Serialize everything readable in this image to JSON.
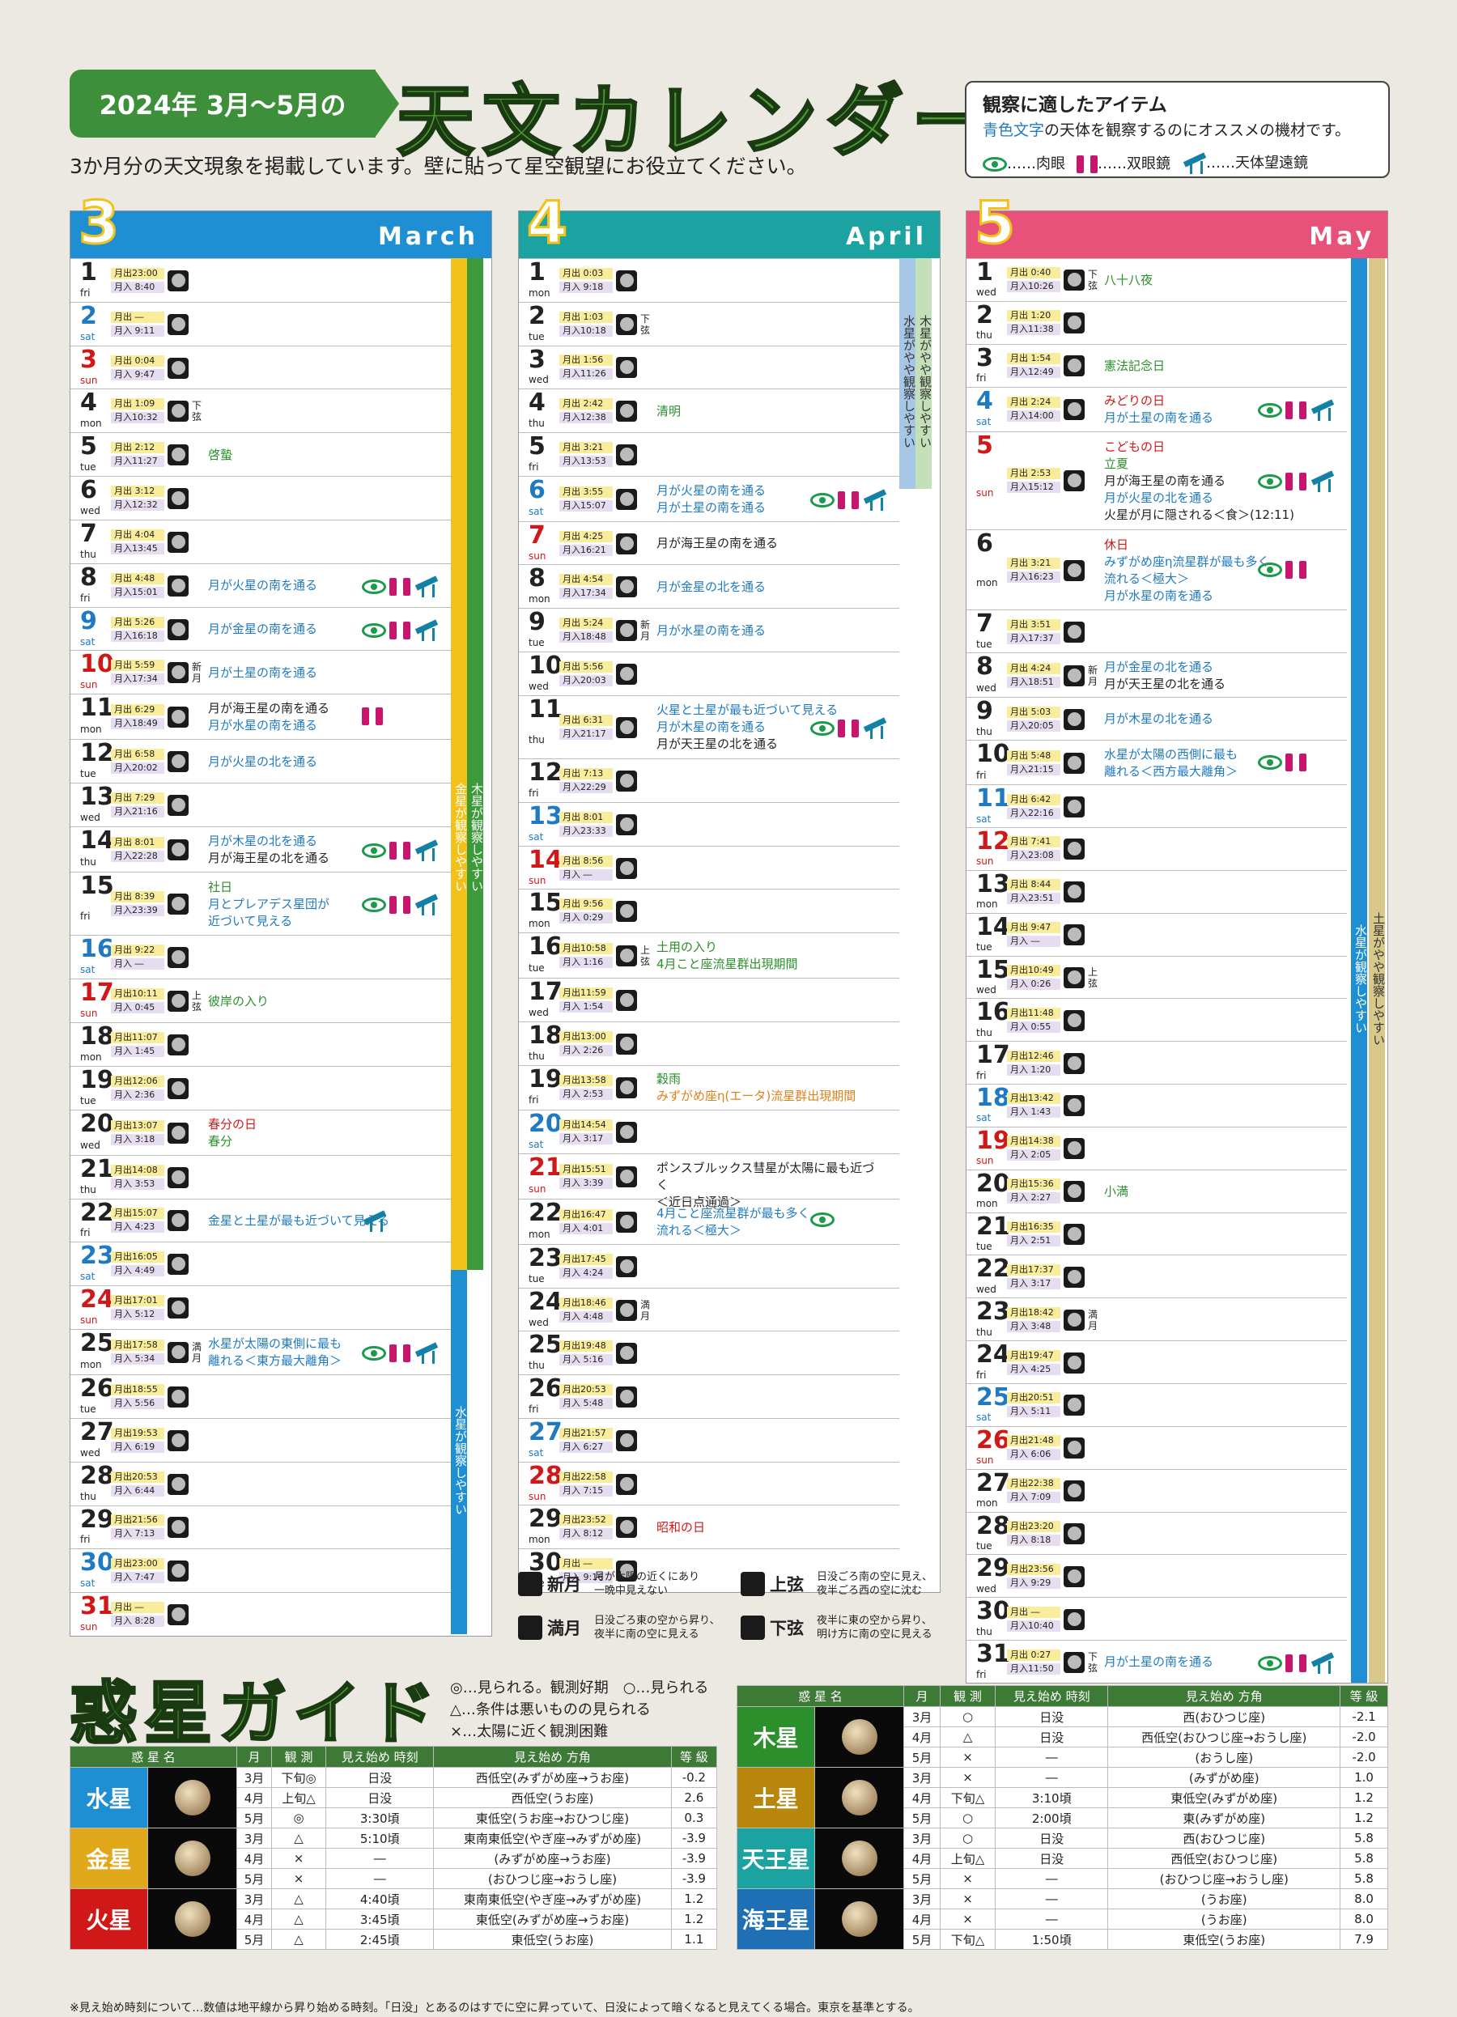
{
  "header": {
    "badge": "2024年 3月～5月の",
    "title": "天文カレンダー",
    "subtitle": "3か月分の天文現象を掲載しています。壁に貼って星空観望にお役立てください。"
  },
  "items_box": {
    "title": "観察に適したアイテム",
    "desc_blue": "青色文字",
    "desc_rest": "の天体を観察するのにオススメの機材です。",
    "eye": "……肉眼",
    "bino": "……双眼鏡",
    "tel": "……天体望遠鏡"
  },
  "months": [
    {
      "num": "3",
      "name": "March",
      "color": "#1f8fd4",
      "days": [
        [
          "1",
          "fri",
          "月出23:00",
          "月入 8:40",
          "",
          "",
          ""
        ],
        [
          "2",
          "sat",
          "月出 ―",
          "月入 9:11",
          "",
          "",
          ""
        ],
        [
          "3",
          "sun",
          "月出 0:04",
          "月入 9:47",
          "",
          "",
          ""
        ],
        [
          "4",
          "mon",
          "月出 1:09",
          "月入10:32",
          "下弦",
          "",
          ""
        ],
        [
          "5",
          "tue",
          "月出 2:12",
          "月入11:27",
          "",
          "啓蟄",
          ""
        ],
        [
          "6",
          "wed",
          "月出 3:12",
          "月入12:32",
          "",
          "",
          ""
        ],
        [
          "7",
          "thu",
          "月出 4:04",
          "月入13:45",
          "",
          "",
          ""
        ],
        [
          "8",
          "fri",
          "月出 4:48",
          "月入15:01",
          "",
          "月が火星の南を通る",
          "EBT"
        ],
        [
          "9",
          "sat",
          "月出 5:26",
          "月入16:18",
          "",
          "月が金星の南を通る",
          "EBT"
        ],
        [
          "10",
          "sun",
          "月出 5:59",
          "月入17:34",
          "新月",
          "月が土星の南を通る",
          ""
        ],
        [
          "11",
          "mon",
          "月出 6:29",
          "月入18:49",
          "",
          "月が海王星の南を通る\n月が水星の南を通る",
          "B"
        ],
        [
          "12",
          "tue",
          "月出 6:58",
          "月入20:02",
          "",
          "月が火星の北を通る",
          ""
        ],
        [
          "13",
          "wed",
          "月出 7:29",
          "月入21:16",
          "",
          "",
          ""
        ],
        [
          "14",
          "thu",
          "月出 8:01",
          "月入22:28",
          "",
          "月が木星の北を通る\n月が海王星の北を通る",
          "EBT"
        ],
        [
          "15",
          "fri",
          "月出 8:39",
          "月入23:39",
          "",
          "社日\n月とプレアデス星団が\n近づいて見える",
          "EBT"
        ],
        [
          "16",
          "sat",
          "月出 9:22",
          "月入 ―",
          "",
          "",
          ""
        ],
        [
          "17",
          "sun",
          "月出10:11",
          "月入 0:45",
          "上弦",
          "彼岸の入り",
          ""
        ],
        [
          "18",
          "mon",
          "月出11:07",
          "月入 1:45",
          "",
          "",
          ""
        ],
        [
          "19",
          "tue",
          "月出12:06",
          "月入 2:36",
          "",
          "",
          ""
        ],
        [
          "20",
          "wed",
          "月出13:07",
          "月入 3:18",
          "",
          "春分の日\n春分",
          ""
        ],
        [
          "21",
          "thu",
          "月出14:08",
          "月入 3:53",
          "",
          "",
          ""
        ],
        [
          "22",
          "fri",
          "月出15:07",
          "月入 4:23",
          "",
          "金星と土星が最も近づいて見える",
          "T"
        ],
        [
          "23",
          "sat",
          "月出16:05",
          "月入 4:49",
          "",
          "",
          ""
        ],
        [
          "24",
          "sun",
          "月出17:01",
          "月入 5:12",
          "",
          "",
          ""
        ],
        [
          "25",
          "mon",
          "月出17:58",
          "月入 5:34",
          "満月",
          "水星が太陽の東側に最も\n離れる＜東方最大離角＞",
          "EBT"
        ],
        [
          "26",
          "tue",
          "月出18:55",
          "月入 5:56",
          "",
          "",
          ""
        ],
        [
          "27",
          "wed",
          "月出19:53",
          "月入 6:19",
          "",
          "",
          ""
        ],
        [
          "28",
          "thu",
          "月出20:53",
          "月入 6:44",
          "",
          "",
          ""
        ],
        [
          "29",
          "fri",
          "月出21:56",
          "月入 7:13",
          "",
          "",
          ""
        ],
        [
          "30",
          "sat",
          "月出23:00",
          "月入 7:47",
          "",
          "",
          ""
        ],
        [
          "31",
          "sun",
          "月出 ―",
          "月入 8:28",
          "",
          "",
          ""
        ]
      ],
      "bars": [
        "金星が観察しやすい",
        "木星が観察しやすい",
        "水星が観察しやすい"
      ]
    },
    {
      "num": "4",
      "name": "April",
      "color": "#1aa3a0",
      "days": [
        [
          "1",
          "mon",
          "月出 0:03",
          "月入 9:18",
          "",
          "",
          ""
        ],
        [
          "2",
          "tue",
          "月出 1:03",
          "月入10:18",
          "下弦",
          "",
          ""
        ],
        [
          "3",
          "wed",
          "月出 1:56",
          "月入11:26",
          "",
          "",
          ""
        ],
        [
          "4",
          "thu",
          "月出 2:42",
          "月入12:38",
          "",
          "清明",
          ""
        ],
        [
          "5",
          "fri",
          "月出 3:21",
          "月入13:53",
          "",
          "",
          ""
        ],
        [
          "6",
          "sat",
          "月出 3:55",
          "月入15:07",
          "",
          "月が火星の南を通る\n月が土星の南を通る",
          "EBT"
        ],
        [
          "7",
          "sun",
          "月出 4:25",
          "月入16:21",
          "",
          "月が海王星の南を通る",
          ""
        ],
        [
          "8",
          "mon",
          "月出 4:54",
          "月入17:34",
          "",
          "月が金星の北を通る",
          ""
        ],
        [
          "9",
          "tue",
          "月出 5:24",
          "月入18:48",
          "新月",
          "月が水星の南を通る",
          ""
        ],
        [
          "10",
          "wed",
          "月出 5:56",
          "月入20:03",
          "",
          "",
          ""
        ],
        [
          "11",
          "thu",
          "月出 6:31",
          "月入21:17",
          "",
          "火星と土星が最も近づいて見える\n月が木星の南を通る\n月が天王星の北を通る",
          "EBT"
        ],
        [
          "12",
          "fri",
          "月出 7:13",
          "月入22:29",
          "",
          "",
          ""
        ],
        [
          "13",
          "sat",
          "月出 8:01",
          "月入23:33",
          "",
          "",
          ""
        ],
        [
          "14",
          "sun",
          "月出 8:56",
          "月入 ―",
          "",
          "",
          ""
        ],
        [
          "15",
          "mon",
          "月出 9:56",
          "月入 0:29",
          "",
          "",
          ""
        ],
        [
          "16",
          "tue",
          "月出10:58",
          "月入 1:16",
          "上弦",
          "土用の入り\n4月こと座流星群出現期間",
          ""
        ],
        [
          "17",
          "wed",
          "月出11:59",
          "月入 1:54",
          "",
          "",
          ""
        ],
        [
          "18",
          "thu",
          "月出13:00",
          "月入 2:26",
          "",
          "",
          ""
        ],
        [
          "19",
          "fri",
          "月出13:58",
          "月入 2:53",
          "",
          "穀雨\nみずがめ座η(エータ)流星群出現期間",
          ""
        ],
        [
          "20",
          "sat",
          "月出14:54",
          "月入 3:17",
          "",
          "",
          ""
        ],
        [
          "21",
          "sun",
          "月出15:51",
          "月入 3:39",
          "",
          "ポンスブルックス彗星が太陽に最も近づく\n＜近日点通過＞",
          ""
        ],
        [
          "22",
          "mon",
          "月出16:47",
          "月入 4:01",
          "",
          "4月こと座流星群が最も多く\n流れる＜極大＞",
          "E"
        ],
        [
          "23",
          "tue",
          "月出17:45",
          "月入 4:24",
          "",
          "",
          ""
        ],
        [
          "24",
          "wed",
          "月出18:46",
          "月入 4:48",
          "満月",
          "",
          ""
        ],
        [
          "25",
          "thu",
          "月出19:48",
          "月入 5:16",
          "",
          "",
          ""
        ],
        [
          "26",
          "fri",
          "月出20:53",
          "月入 5:48",
          "",
          "",
          ""
        ],
        [
          "27",
          "sat",
          "月出21:57",
          "月入 6:27",
          "",
          "",
          ""
        ],
        [
          "28",
          "sun",
          "月出22:58",
          "月入 7:15",
          "",
          "",
          ""
        ],
        [
          "29",
          "mon",
          "月出23:52",
          "月入 8:12",
          "",
          "昭和の日",
          ""
        ],
        [
          "30",
          "tue",
          "月出 ―",
          "月入 9:16",
          "",
          "",
          ""
        ]
      ],
      "bars": [
        "水星がやや観察しやすい",
        "木星がやや観察しやすい"
      ]
    },
    {
      "num": "5",
      "name": "May",
      "color": "#e8517a",
      "days": [
        [
          "1",
          "wed",
          "月出 0:40",
          "月入10:26",
          "下弦",
          "八十八夜",
          ""
        ],
        [
          "2",
          "thu",
          "月出 1:20",
          "月入11:38",
          "",
          "",
          ""
        ],
        [
          "3",
          "fri",
          "月出 1:54",
          "月入12:49",
          "",
          "憲法記念日",
          ""
        ],
        [
          "4",
          "sat",
          "月出 2:24",
          "月入14:00",
          "",
          "みどりの日\n月が土星の南を通る",
          "EBT"
        ],
        [
          "5",
          "sun",
          "月出 2:53",
          "月入15:12",
          "",
          "こどもの日\n立夏\n月が海王星の南を通る\n月が火星の北を通る\n火星が月に隠される＜食＞(12:11)",
          "EBT"
        ],
        [
          "6",
          "mon",
          "月出 3:21",
          "月入16:23",
          "",
          "休日\nみずがめ座η流星群が最も多く\n流れる＜極大＞\n月が水星の南を通る",
          "EB"
        ],
        [
          "7",
          "tue",
          "月出 3:51",
          "月入17:37",
          "",
          "",
          ""
        ],
        [
          "8",
          "wed",
          "月出 4:24",
          "月入18:51",
          "新月",
          "月が金星の北を通る\n月が天王星の北を通る",
          ""
        ],
        [
          "9",
          "thu",
          "月出 5:03",
          "月入20:05",
          "",
          "月が木星の北を通る",
          ""
        ],
        [
          "10",
          "fri",
          "月出 5:48",
          "月入21:15",
          "",
          "水星が太陽の西側に最も\n離れる＜西方最大離角＞",
          "EB"
        ],
        [
          "11",
          "sat",
          "月出 6:42",
          "月入22:16",
          "",
          "",
          ""
        ],
        [
          "12",
          "sun",
          "月出 7:41",
          "月入23:08",
          "",
          "",
          ""
        ],
        [
          "13",
          "mon",
          "月出 8:44",
          "月入23:51",
          "",
          "",
          ""
        ],
        [
          "14",
          "tue",
          "月出 9:47",
          "月入 ―",
          "",
          "",
          ""
        ],
        [
          "15",
          "wed",
          "月出10:49",
          "月入 0:26",
          "上弦",
          "",
          ""
        ],
        [
          "16",
          "thu",
          "月出11:48",
          "月入 0:55",
          "",
          "",
          ""
        ],
        [
          "17",
          "fri",
          "月出12:46",
          "月入 1:20",
          "",
          "",
          ""
        ],
        [
          "18",
          "sat",
          "月出13:42",
          "月入 1:43",
          "",
          "",
          ""
        ],
        [
          "19",
          "sun",
          "月出14:38",
          "月入 2:05",
          "",
          "",
          ""
        ],
        [
          "20",
          "mon",
          "月出15:36",
          "月入 2:27",
          "",
          "小満",
          ""
        ],
        [
          "21",
          "tue",
          "月出16:35",
          "月入 2:51",
          "",
          "",
          ""
        ],
        [
          "22",
          "wed",
          "月出17:37",
          "月入 3:17",
          "",
          "",
          ""
        ],
        [
          "23",
          "thu",
          "月出18:42",
          "月入 3:48",
          "満月",
          "",
          ""
        ],
        [
          "24",
          "fri",
          "月出19:47",
          "月入 4:25",
          "",
          "",
          ""
        ],
        [
          "25",
          "sat",
          "月出20:51",
          "月入 5:11",
          "",
          "",
          ""
        ],
        [
          "26",
          "sun",
          "月出21:48",
          "月入 6:06",
          "",
          "",
          ""
        ],
        [
          "27",
          "mon",
          "月出22:38",
          "月入 7:09",
          "",
          "",
          ""
        ],
        [
          "28",
          "tue",
          "月出23:20",
          "月入 8:18",
          "",
          "",
          ""
        ],
        [
          "29",
          "wed",
          "月出23:56",
          "月入 9:29",
          "",
          "",
          ""
        ],
        [
          "30",
          "thu",
          "月出 ―",
          "月入10:40",
          "",
          "",
          ""
        ],
        [
          "31",
          "fri",
          "月出 0:27",
          "月入11:50",
          "下弦",
          "月が土星の南を通る",
          "EBT"
        ]
      ],
      "bars": [
        "水星が観察しやすい",
        "土星がやや観察しやすい"
      ]
    }
  ],
  "moon_legend": [
    [
      "新月",
      "月が太陽の近くにあり\n一晩中見えない"
    ],
    [
      "満月",
      "日没ごろ東の空から昇り、\n夜半に南の空に見える"
    ],
    [
      "上弦",
      "日没ごろ南の空に見え、\n夜半ごろ西の空に沈む"
    ],
    [
      "下弦",
      "夜半に東の空から昇り、\n明け方に南の空に見える"
    ]
  ],
  "planet_guide": {
    "title": "惑星ガイド",
    "notes": [
      "◎…見られる。観測好期　○…見られる",
      "△…条件は悪いものの見られる",
      "×…太陽に近く観測困難"
    ],
    "headers": [
      "惑 星 名",
      "月",
      "観 測",
      "見え始め 時刻",
      "見え始め 方角",
      "等 級"
    ],
    "left": [
      {
        "name": "水星",
        "color": "#1f8fd4",
        "rows": [
          [
            "3月",
            "下旬◎",
            "日没",
            "西低空(みずがめ座→うお座)",
            "-0.2"
          ],
          [
            "4月",
            "上旬△",
            "日没",
            "西低空(うお座)",
            "2.6"
          ],
          [
            "5月",
            "◎",
            "3:30頃",
            "東低空(うお座→おひつじ座)",
            "0.3"
          ]
        ]
      },
      {
        "name": "金星",
        "color": "#e0a81a",
        "rows": [
          [
            "3月",
            "△",
            "5:10頃",
            "東南東低空(やぎ座→みずがめ座)",
            "-3.9"
          ],
          [
            "4月",
            "×",
            "―",
            "(みずがめ座→うお座)",
            "-3.9"
          ],
          [
            "5月",
            "×",
            "―",
            "(おひつじ座→おうし座)",
            "-3.9"
          ]
        ]
      },
      {
        "name": "火星",
        "color": "#d01818",
        "rows": [
          [
            "3月",
            "△",
            "4:40頃",
            "東南東低空(やぎ座→みずがめ座)",
            "1.2"
          ],
          [
            "4月",
            "△",
            "3:45頃",
            "東低空(みずがめ座→うお座)",
            "1.2"
          ],
          [
            "5月",
            "△",
            "2:45頃",
            "東低空(うお座)",
            "1.1"
          ]
        ]
      }
    ],
    "right": [
      {
        "name": "木星",
        "color": "#2b8f2b",
        "rows": [
          [
            "3月",
            "○",
            "日没",
            "西(おひつじ座)",
            "-2.1"
          ],
          [
            "4月",
            "△",
            "日没",
            "西低空(おひつじ座→おうし座)",
            "-2.0"
          ],
          [
            "5月",
            "×",
            "―",
            "(おうし座)",
            "-2.0"
          ]
        ]
      },
      {
        "name": "土星",
        "color": "#b8860b",
        "rows": [
          [
            "3月",
            "×",
            "―",
            "(みずがめ座)",
            "1.0"
          ],
          [
            "4月",
            "下旬△",
            "3:10頃",
            "東低空(みずがめ座)",
            "1.2"
          ],
          [
            "5月",
            "○",
            "2:00頃",
            "東(みずがめ座)",
            "1.2"
          ]
        ]
      },
      {
        "name": "天王星",
        "color": "#1aa3a0",
        "rows": [
          [
            "3月",
            "○",
            "日没",
            "西(おひつじ座)",
            "5.8"
          ],
          [
            "4月",
            "上旬△",
            "日没",
            "西低空(おひつじ座)",
            "5.8"
          ],
          [
            "5月",
            "×",
            "―",
            "(おひつじ座→おうし座)",
            "5.8"
          ]
        ]
      },
      {
        "name": "海王星",
        "color": "#1f6fb4",
        "rows": [
          [
            "3月",
            "×",
            "―",
            "(うお座)",
            "8.0"
          ],
          [
            "4月",
            "×",
            "―",
            "(うお座)",
            "8.0"
          ],
          [
            "5月",
            "下旬△",
            "1:50頃",
            "東低空(うお座)",
            "7.9"
          ]
        ]
      }
    ]
  },
  "footnote": "※見え始め時刻について…数値は地平線から昇り始める時刻。「日没」とあるのはすでに空に昇っていて、日没によって暗くなると見えてくる場合。東京を基準とする。"
}
